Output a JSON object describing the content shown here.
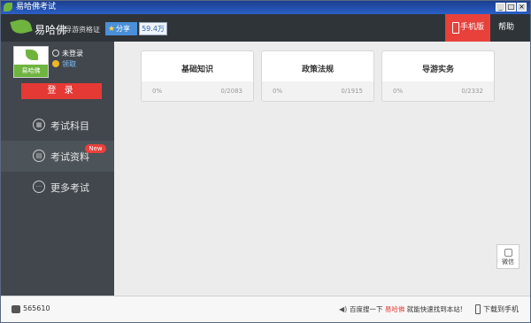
{
  "window": {
    "title": "易哈佛考试",
    "controls": [
      "_",
      "□",
      "×"
    ]
  },
  "header": {
    "logo_text": "易哈佛",
    "exam_name": "导游资格证",
    "share_label": "分享",
    "share_count": "59.4万",
    "mobile_label": "手机版",
    "help_label": "帮助"
  },
  "user": {
    "avatar_label": "易哈佛",
    "login_state": "未登录",
    "claim_label": "领取",
    "login_button": "登 录"
  },
  "sidebar": {
    "items": [
      {
        "label": "考试科目",
        "icon": "grid-icon"
      },
      {
        "label": "考试资料",
        "icon": "document-icon",
        "badge": "New"
      },
      {
        "label": "更多考试",
        "icon": "more-icon"
      }
    ]
  },
  "cards": [
    {
      "title": "基础知识",
      "percent": "0%",
      "count": "0/2083"
    },
    {
      "title": "政策法规",
      "percent": "0%",
      "count": "0/1915"
    },
    {
      "title": "导游实务",
      "percent": "0%",
      "count": "0/2332"
    }
  ],
  "floating": {
    "wechat_label": "微信"
  },
  "status": {
    "likes": "565610",
    "hint_prefix": "百度搜一下",
    "hint_brand": "易哈佛",
    "hint_suffix": "就能快速找到本站!",
    "download_label": "下载到手机"
  },
  "colors": {
    "accent_red": "#e8413b",
    "brand_green": "#6fb43f",
    "sidebar_bg": "#41474d",
    "header_bg": "#2f3439"
  }
}
